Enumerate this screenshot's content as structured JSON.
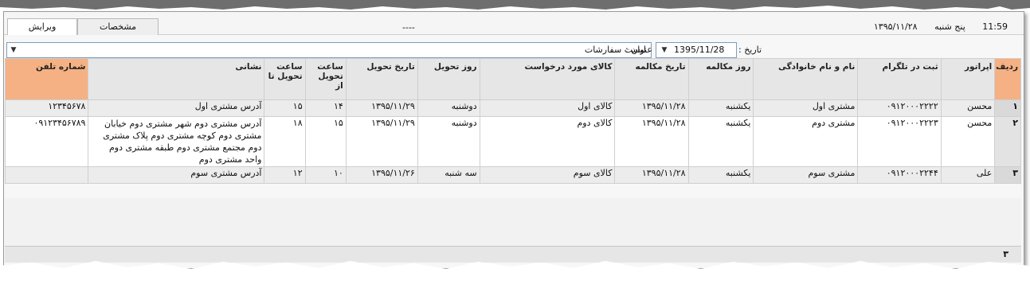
{
  "tabs": [
    {
      "label": "ویرایش"
    },
    {
      "label": "مشخصات"
    }
  ],
  "header": {
    "center_text": "----",
    "weekday": "پنج شنبه",
    "date": "۱۳۹۵/۱۱/۲۸",
    "time": "11:59"
  },
  "filters": {
    "date_label": "تاریخ :",
    "date_value": "1395/11/28",
    "title_label": "عنوان :",
    "title_value": "لیست سفارشات"
  },
  "table": {
    "columns": [
      "ردیف",
      "اپراتور",
      "ثبت در تلگرام",
      "نام و نام خانوادگی",
      "روز مکالمه",
      "تاریخ مکالمه",
      "کالای مورد درخواست",
      "روز تحویل",
      "تاریخ تحویل",
      "ساعت تحویل از",
      "ساعت تحویل تا",
      "نشانی",
      "شماره تلفن"
    ],
    "rows": [
      [
        "۱",
        "محسن",
        "۰۹۱۲۰۰۰۲۲۲۲",
        "مشتری اول",
        "یکشنبه",
        "۱۳۹۵/۱۱/۲۸",
        "کالای اول",
        "دوشنبه",
        "۱۳۹۵/۱۱/۲۹",
        "۱۴",
        "۱۵",
        "آدرس مشتری اول",
        "۱۲۳۴۵۶۷۸"
      ],
      [
        "۲",
        "محسن",
        "۰۹۱۲۰۰۰۲۲۲۳",
        "مشتری دوم",
        "یکشنبه",
        "۱۳۹۵/۱۱/۲۸",
        "کالای دوم",
        "دوشنبه",
        "۱۳۹۵/۱۱/۲۹",
        "۱۵",
        "۱۸",
        "آدرس مشتری دوم شهر مشتری دوم خیابان مشتری دوم کوچه مشتری دوم پلاک مشتری دوم مجتمع مشتری دوم طبقه مشتری دوم واحد مشتری دوم",
        "۰۹۱۲۳۴۵۶۷۸۹"
      ],
      [
        "۳",
        "علی",
        "۰۹۱۲۰۰۰۲۲۴۴",
        "مشتری سوم",
        "یکشنبه",
        "۱۳۹۵/۱۱/۲۸",
        "کالای سوم",
        "سه شنبه",
        "۱۳۹۵/۱۱/۲۶",
        "۱۰",
        "۱۲",
        "آدرس مشتری سوم",
        ""
      ]
    ],
    "footer_count": "۳"
  },
  "colors": {
    "header_bg": "#e6e6e6",
    "highlight_header": "#f5b183",
    "selected_row": "#ececec"
  },
  "icons": [
    "dropdown-arrow-icon"
  ]
}
